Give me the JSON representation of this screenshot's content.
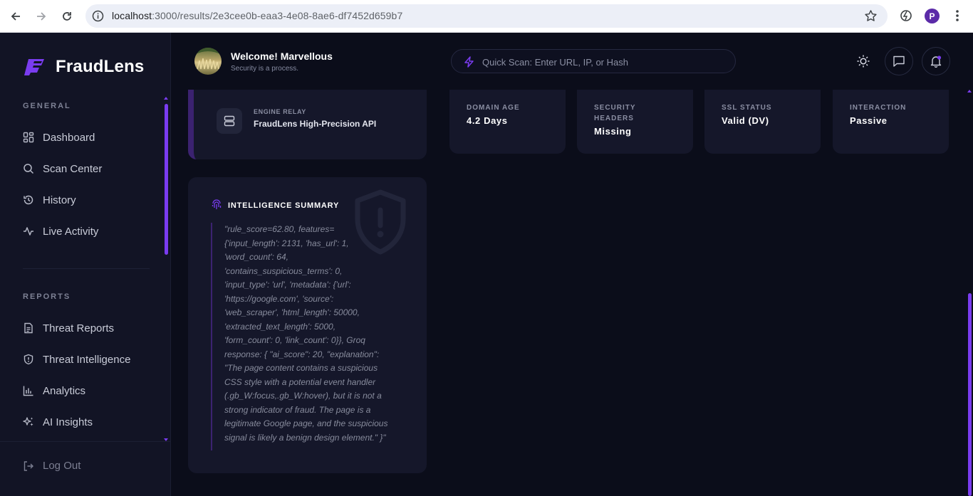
{
  "browser": {
    "url_host": "localhost",
    "url_path": ":3000/results/2e3cee0b-eaa3-4e08-8ae6-df7452d659b7",
    "profile_initial": "P"
  },
  "app": {
    "name": "FraudLens",
    "brand_color": "#7a3cf0"
  },
  "sidebar": {
    "general_label": "GENERAL",
    "general_items": [
      {
        "label": "Dashboard",
        "icon": "dashboard-grid-icon"
      },
      {
        "label": "Scan Center",
        "icon": "search-icon"
      },
      {
        "label": "History",
        "icon": "history-icon"
      },
      {
        "label": "Live Activity",
        "icon": "activity-pulse-icon"
      }
    ],
    "reports_label": "REPORTS",
    "reports_items": [
      {
        "label": "Threat Reports",
        "icon": "document-icon"
      },
      {
        "label": "Threat Intelligence",
        "icon": "shield-alert-icon"
      },
      {
        "label": "Analytics",
        "icon": "bar-chart-icon"
      },
      {
        "label": "AI Insights",
        "icon": "sparkles-icon"
      }
    ],
    "logout_label": "Log Out"
  },
  "header": {
    "welcome": "Welcome! Marvellous",
    "tagline": "Security is a process.",
    "quickscan_placeholder": "Quick Scan: Enter URL, IP, or Hash"
  },
  "engine": {
    "label": "ENGINE RELAY",
    "value": "FraudLens High-Precision API"
  },
  "stats": [
    {
      "label": "DOMAIN AGE",
      "value": "4.2 Days"
    },
    {
      "label": "SECURITY HEADERS",
      "value": "Missing"
    },
    {
      "label": "SSL STATUS",
      "value": "Valid (DV)"
    },
    {
      "label": "INTERACTION",
      "value": "Passive"
    }
  ],
  "summary": {
    "title": "INTELLIGENCE SUMMARY",
    "text": "\"rule_score=62.80, features=\n{'input_length': 2131, 'has_url': 1,\n'word_count': 64,\n'contains_suspicious_terms': 0,\n'input_type': 'url', 'metadata': {'url':\n'https://google.com', 'source':\n'web_scraper', 'html_length': 50000,\n'extracted_text_length': 5000,\n'form_count': 0, 'link_count': 0}}, Groq\nresponse: { \"ai_score\": 20, \"explanation\":\n\"The page content contains a suspicious\nCSS style with a potential event handler\n(.gb_W:focus,.gb_W:hover), but it is not a\nstrong indicator of fraud. The page is a\nlegitimate Google page, and the suspicious\nsignal is likely a benign design element.\" }\""
  }
}
